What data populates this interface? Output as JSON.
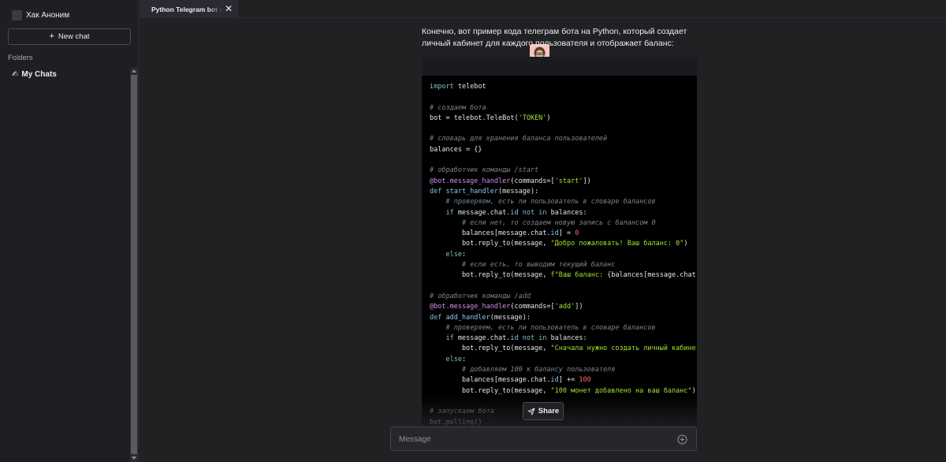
{
  "sidebar": {
    "user_name": "Хак Аноним",
    "new_chat_label": "New chat",
    "folders_label": "Folders",
    "my_chats_emoji": "✍",
    "my_chats_label": "My Chats"
  },
  "tab": {
    "title": "Python Telegram bot with",
    "close": "✕"
  },
  "message": {
    "text": "Конечно, вот пример кода телеграм бота на Python, который создает личный кабинет для каждого пользователя и отображает баланс:"
  },
  "share_label": "Share",
  "input": {
    "placeholder": "Message"
  },
  "colors": {
    "background": "#202123",
    "sidebar": "#1e1f22",
    "code_bg": "#000000"
  },
  "icons": {
    "send": "plus-circle-icon",
    "share": "paper-plane-icon"
  }
}
